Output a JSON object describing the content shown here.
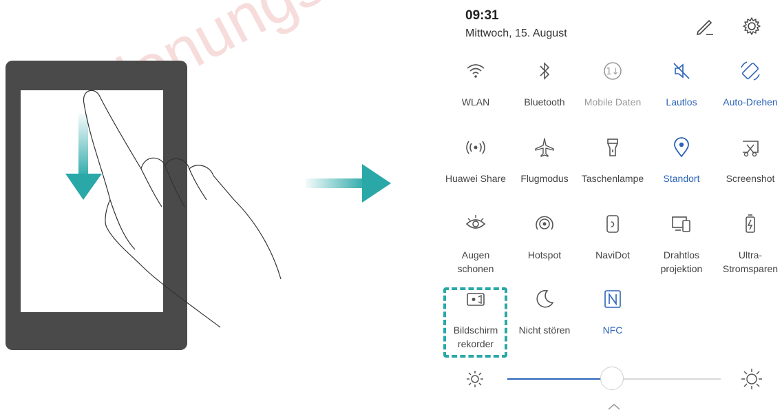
{
  "watermark": "Bedienungs",
  "header": {
    "time": "09:31",
    "date": "Mittwoch, 15. August"
  },
  "tiles": [
    {
      "label": "WLAN",
      "icon": "wifi-icon",
      "state": "normal"
    },
    {
      "label": "Bluetooth",
      "icon": "bluetooth-icon",
      "state": "normal"
    },
    {
      "label": "Mobile Daten",
      "icon": "mobile-data-icon",
      "state": "disabled"
    },
    {
      "label": "Lautlos",
      "icon": "mute-icon",
      "state": "active"
    },
    {
      "label": "Auto-Drehen",
      "icon": "auto-rotate-icon",
      "state": "active"
    },
    {
      "label": "Huawei Share",
      "icon": "huawei-share-icon",
      "state": "normal"
    },
    {
      "label": "Flugmodus",
      "icon": "airplane-icon",
      "state": "normal"
    },
    {
      "label": "Taschenlampe",
      "icon": "flashlight-icon",
      "state": "normal"
    },
    {
      "label": "Standort",
      "icon": "location-icon",
      "state": "active"
    },
    {
      "label": "Screenshot",
      "icon": "screenshot-icon",
      "state": "normal"
    },
    {
      "label": "Augen\nschonen",
      "icon": "eye-comfort-icon",
      "state": "normal"
    },
    {
      "label": "Hotspot",
      "icon": "hotspot-icon",
      "state": "normal"
    },
    {
      "label": "NaviDot",
      "icon": "navidot-icon",
      "state": "normal"
    },
    {
      "label": "Drahtlos\nprojektion",
      "icon": "wireless-projection-icon",
      "state": "normal"
    },
    {
      "label": "Ultra-\nStromsparen",
      "icon": "ultra-power-saving-icon",
      "state": "normal"
    },
    {
      "label": "Bildschirm\nrekorder",
      "icon": "screen-recorder-icon",
      "state": "normal"
    },
    {
      "label": "Nicht stören",
      "icon": "do-not-disturb-icon",
      "state": "normal"
    },
    {
      "label": "NFC",
      "icon": "nfc-icon",
      "state": "active"
    }
  ],
  "brightness": {
    "level": 0.49
  },
  "colors": {
    "accent": "#2b63b8",
    "icon_normal": "#555555",
    "icon_disabled": "#9a9a9a",
    "highlight": "#2aa8a8",
    "arrow": "#2aa8a8",
    "device": "#4a4a4a"
  }
}
